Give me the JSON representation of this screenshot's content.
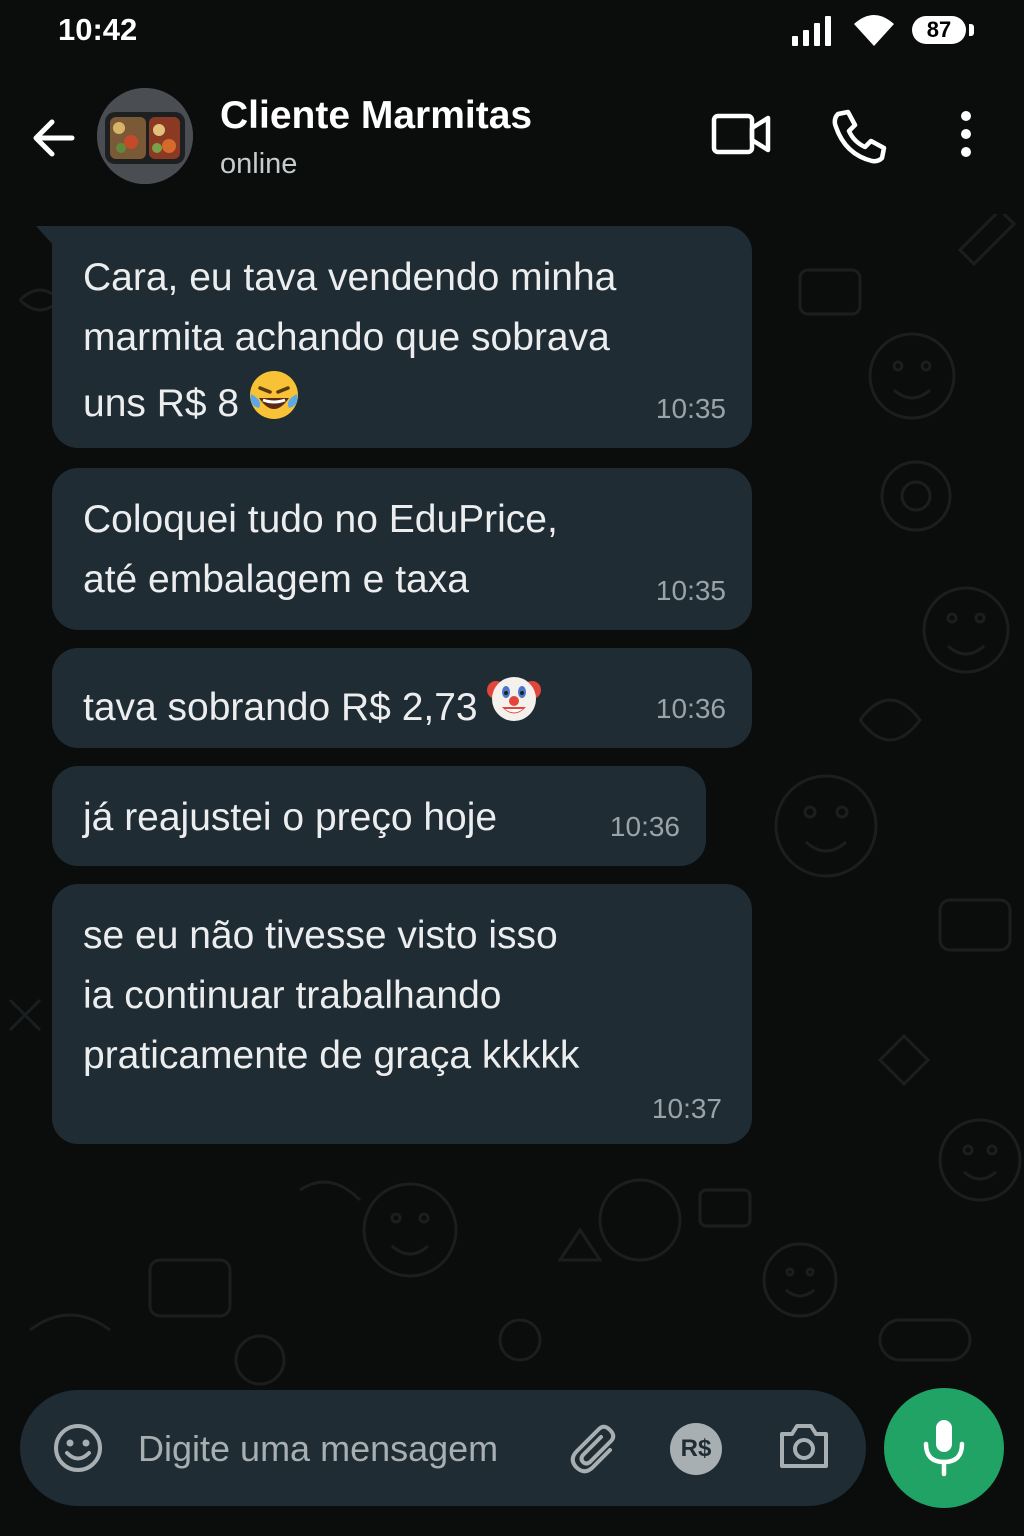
{
  "status_bar": {
    "time": "10:42",
    "battery": "87"
  },
  "header": {
    "contact_name": "Cliente Marmitas",
    "contact_status": "online"
  },
  "messages": [
    {
      "lines": [
        "Cara, eu tava vendendo minha",
        "marmita achando que sobrava",
        "uns R$ 8"
      ],
      "emoji": "laughing-tears-emoji",
      "time": "10:35"
    },
    {
      "lines": [
        "Coloquei tudo no EduPrice,",
        "até embalagem e taxa"
      ],
      "time": "10:35"
    },
    {
      "lines": [
        "tava sobrando R$ 2,73"
      ],
      "emoji": "clown-emoji",
      "time": "10:36"
    },
    {
      "lines": [
        "já reajustei o preço hoje"
      ],
      "time": "10:36"
    },
    {
      "lines": [
        "se eu não tivesse visto isso",
        "ia continuar trabalhando",
        "praticamente de graça kkkkk"
      ],
      "time": "10:37"
    }
  ],
  "input_bar": {
    "placeholder": "Digite uma mensagem",
    "pix_label": "R$"
  },
  "colors": {
    "background": "#0b0c0c",
    "bubble": "#202c33",
    "input_bar": "#1f2c33",
    "mic_button": "#21a366"
  }
}
